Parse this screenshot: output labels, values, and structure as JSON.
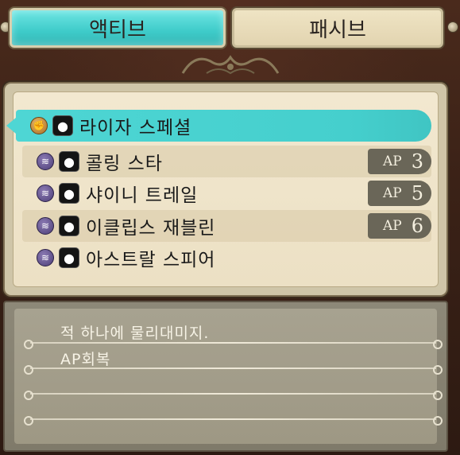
{
  "tabs": {
    "active_label": "액티브",
    "inactive_label": "패시브"
  },
  "skills": [
    {
      "name": "라이자 스페셜",
      "type_icon": "fist-icon",
      "item_icon": "bomb-icon",
      "ap_label": "",
      "ap_value": "",
      "selected": true
    },
    {
      "name": "콜링 스타",
      "type_icon": "wave-icon",
      "item_icon": "bomb-icon",
      "ap_label": "AP",
      "ap_value": "3",
      "selected": false
    },
    {
      "name": "샤이니 트레일",
      "type_icon": "wave-icon",
      "item_icon": "bomb-icon",
      "ap_label": "AP",
      "ap_value": "5",
      "selected": false
    },
    {
      "name": "이클립스 재블린",
      "type_icon": "wave-icon",
      "item_icon": "bomb-icon",
      "ap_label": "AP",
      "ap_value": "6",
      "selected": false
    },
    {
      "name": "아스트랄 스피어",
      "type_icon": "wave-icon",
      "item_icon": "bomb-icon",
      "ap_label": "",
      "ap_value": "",
      "selected": false
    }
  ],
  "description": {
    "line1": "적 하나에 물리대미지.",
    "line2": "AP회복"
  },
  "colors": {
    "accent_cyan": "#4ed6d4",
    "panel_parchment": "#f2e8d0",
    "ap_badge": "#6a6658"
  }
}
